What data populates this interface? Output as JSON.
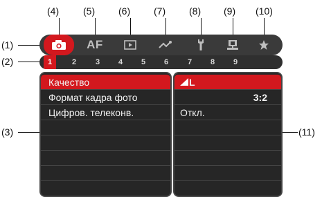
{
  "callouts": {
    "tabs": [
      "(4)",
      "(5)",
      "(6)",
      "(7)",
      "(8)",
      "(9)",
      "(10)"
    ],
    "left_1": "(1)",
    "left_2": "(2)",
    "left_3": "(3)",
    "right_11": "(11)"
  },
  "tabs": [
    {
      "icon": "camera-icon",
      "active": true
    },
    {
      "label": "AF",
      "active": false
    },
    {
      "icon": "playback-icon",
      "active": false
    },
    {
      "icon": "wireless-icon",
      "active": false
    },
    {
      "icon": "wrench-icon",
      "active": false
    },
    {
      "icon": "custom-functions-icon",
      "active": false
    },
    {
      "icon": "star-icon",
      "active": false
    }
  ],
  "pages": [
    "1",
    "2",
    "3",
    "4",
    "5",
    "6",
    "7",
    "8",
    "9"
  ],
  "active_page": "1",
  "menu": {
    "items": [
      "Качество",
      "Формат кадра фото",
      "Цифров. телеконв.",
      "",
      "",
      "",
      "",
      ""
    ],
    "values": [
      "L",
      "3:2",
      "Откл.",
      "",
      "",
      "",
      "",
      ""
    ],
    "selected_index": 0
  },
  "colors": {
    "accent": "#d3181e",
    "tab_bar": "#3a3a3a",
    "panel": "#262626"
  }
}
